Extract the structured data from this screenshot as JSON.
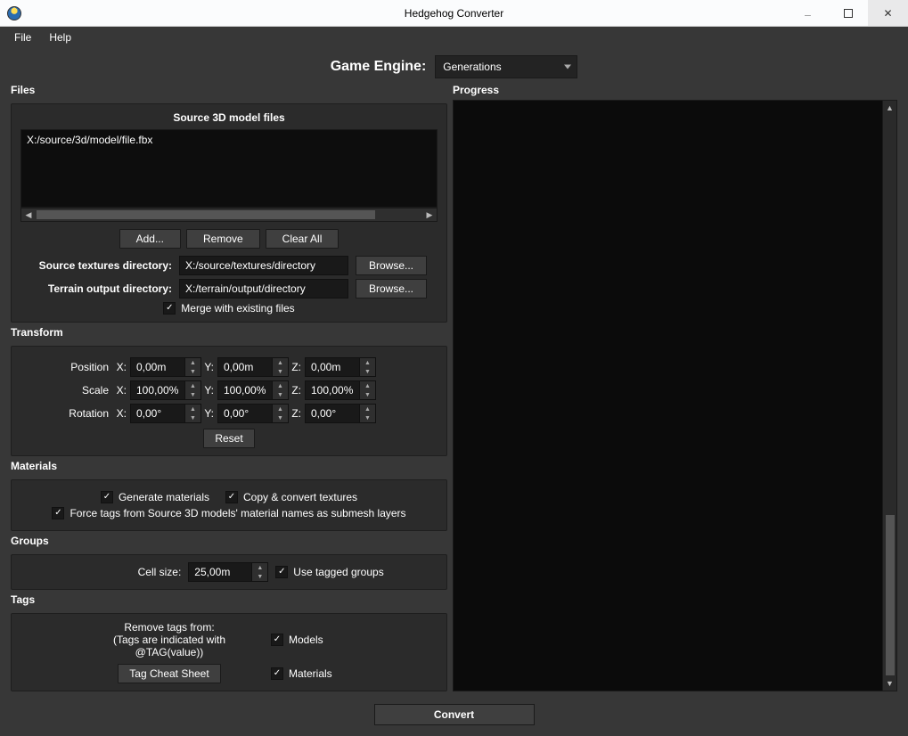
{
  "window": {
    "title": "Hedgehog Converter"
  },
  "menu": {
    "file": "File",
    "help": "Help"
  },
  "engine": {
    "label": "Game Engine:",
    "value": "Generations"
  },
  "winctrl": {
    "min": "—",
    "max": "▢",
    "close": "✕"
  },
  "files": {
    "section": "Files",
    "heading": "Source 3D model files",
    "list": [
      "X:/source/3d/model/file.fbx"
    ],
    "add": "Add...",
    "remove": "Remove",
    "clear": "Clear All",
    "texLabel": "Source textures directory:",
    "texPath": "X:/source/textures/directory",
    "outLabel": "Terrain output directory:",
    "outPath": "X:/terrain/output/directory",
    "browse": "Browse...",
    "merge": "Merge with existing files"
  },
  "transform": {
    "section": "Transform",
    "position": "Position",
    "scale": "Scale",
    "rotation": "Rotation",
    "x": "X:",
    "y": "Y:",
    "z": "Z:",
    "posVal": "0,00m",
    "scaleVal": "100,00%",
    "rotVal": "0,00°",
    "reset": "Reset"
  },
  "materials": {
    "section": "Materials",
    "gen": "Generate materials",
    "copy": "Copy & convert textures",
    "force": "Force tags from Source 3D models' material names as submesh layers"
  },
  "groups": {
    "section": "Groups",
    "cellLabel": "Cell size:",
    "cellVal": "25,00m",
    "tagged": "Use tagged groups"
  },
  "tags": {
    "section": "Tags",
    "hint1": "Remove tags from:",
    "hint2": "(Tags are indicated with @TAG(value))",
    "models": "Models",
    "materials": "Materials",
    "sheet": "Tag Cheat Sheet"
  },
  "progress": {
    "section": "Progress"
  },
  "footer": {
    "convert": "Convert"
  }
}
